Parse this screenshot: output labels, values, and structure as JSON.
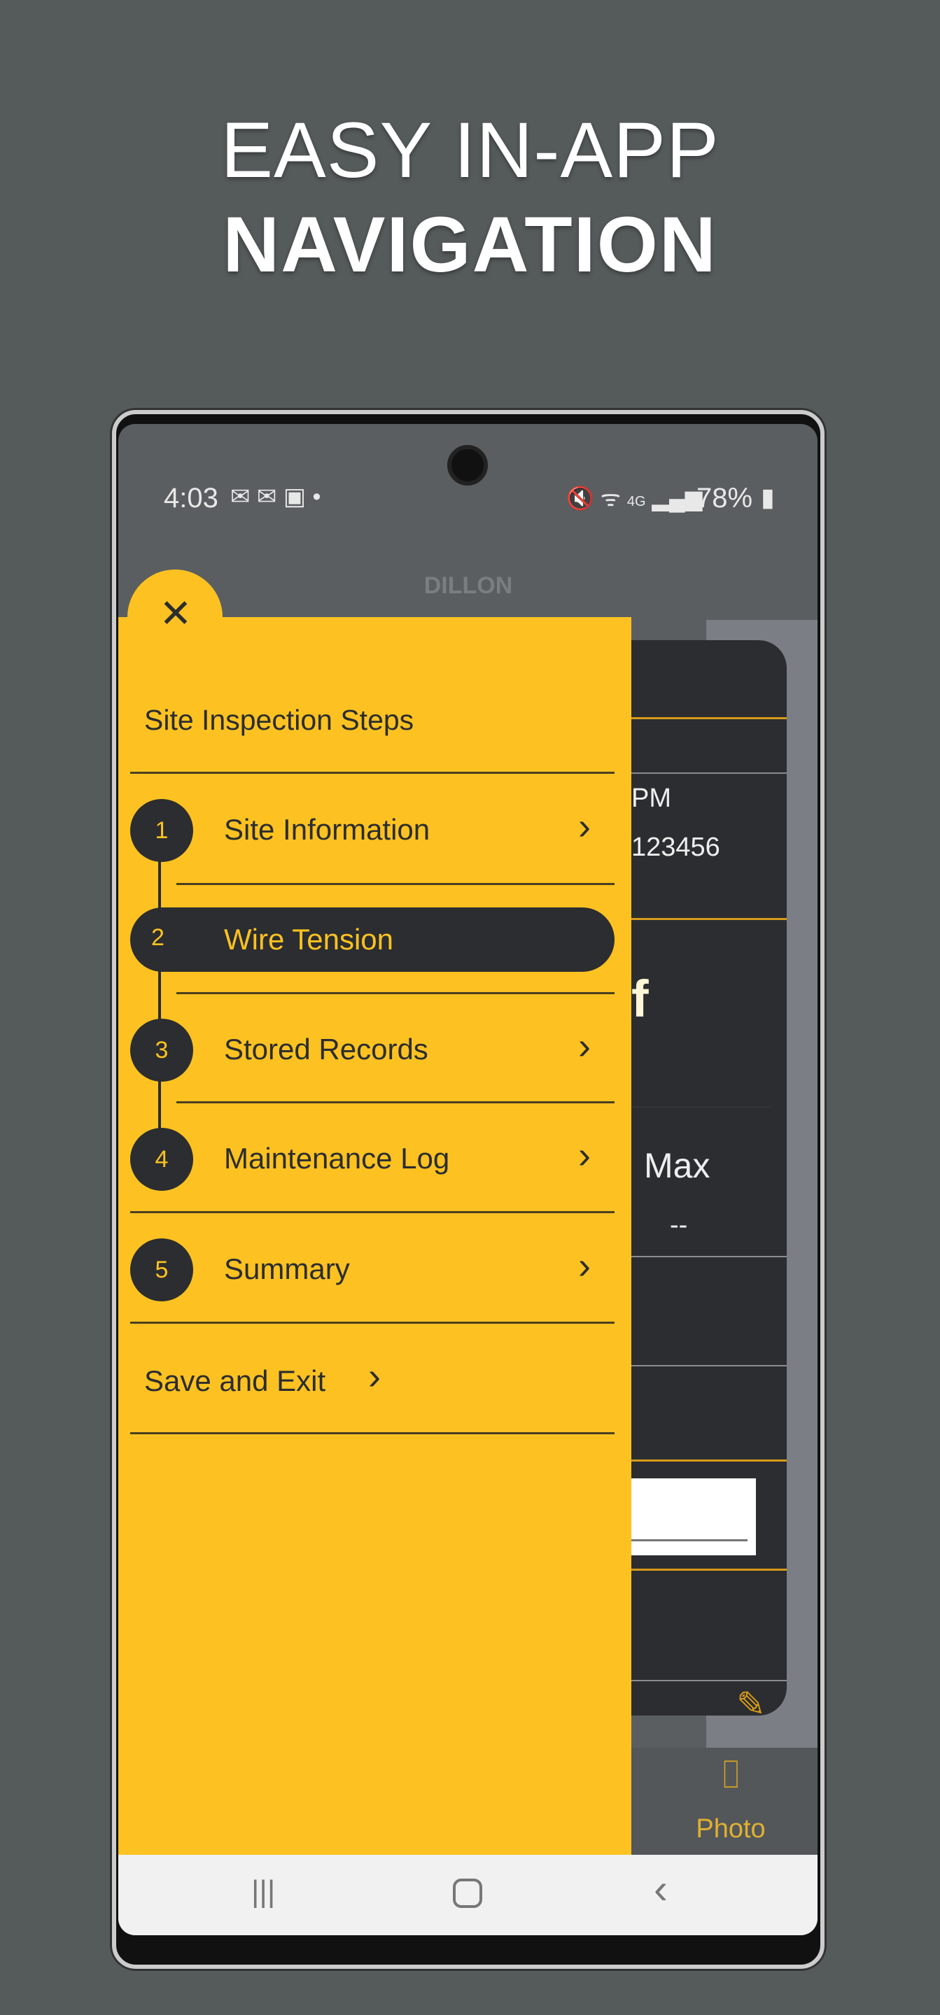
{
  "headline": {
    "line1": "EASY IN-APP",
    "line2": "NAVIGATION"
  },
  "status_bar": {
    "time": "4:03",
    "network": "4G",
    "battery": "78%"
  },
  "app": {
    "logo": "DILLON"
  },
  "drawer": {
    "title": "Site Inspection Steps",
    "close_icon": "close-icon",
    "active_step": 2,
    "steps": [
      {
        "number": "1",
        "label": "Site Information"
      },
      {
        "number": "2",
        "label": "Wire Tension"
      },
      {
        "number": "3",
        "label": "Stored Records"
      },
      {
        "number": "4",
        "label": "Maintenance Log"
      },
      {
        "number": "5",
        "label": "Summary"
      }
    ],
    "save_exit": "Save and Exit"
  },
  "background_content": {
    "time_fragment": "PM",
    "id_fragment": "123456",
    "unit_fragment": "f",
    "max_label": "Max",
    "max_value": "--"
  },
  "toolbar": {
    "photo_label": "Photo"
  },
  "colors": {
    "accent": "#fdc221",
    "dark": "#2b2d30",
    "background": "#555a5a"
  }
}
